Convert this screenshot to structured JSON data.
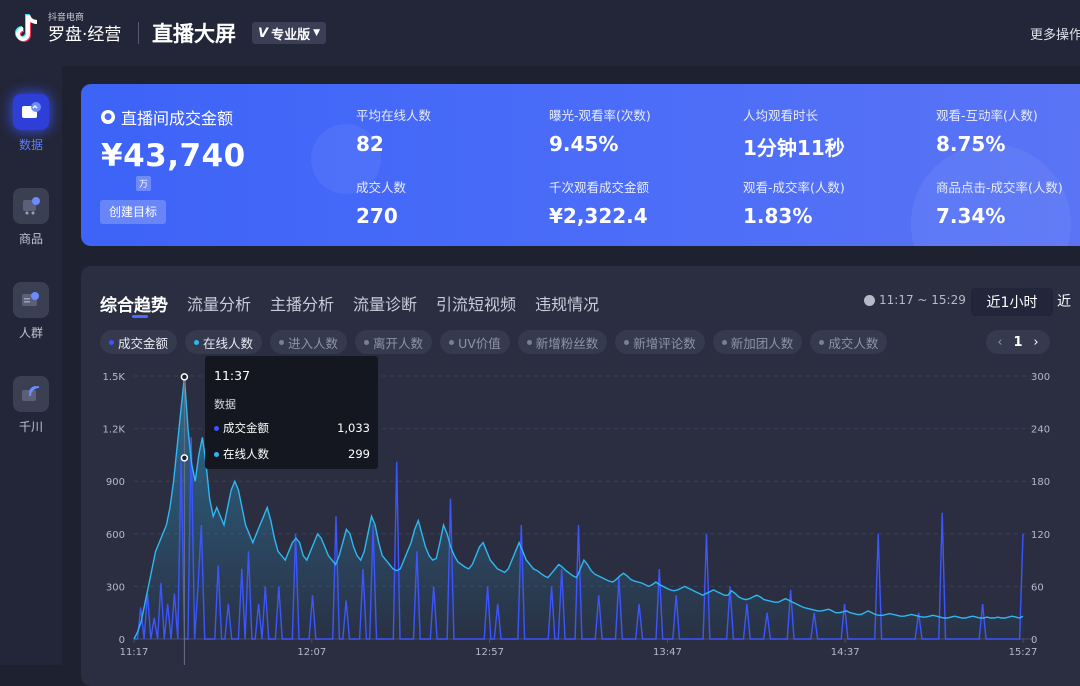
{
  "app": {
    "logo_small": "抖音电商",
    "logo_main": "罗盘·经营",
    "page_title": "直播大屏",
    "edition": "专业版",
    "more": "更多操作"
  },
  "sidebar": [
    {
      "label": "数据",
      "icon": "data-chart-icon",
      "active": true
    },
    {
      "label": "商品",
      "icon": "shopping-cart-icon",
      "active": false
    },
    {
      "label": "人群",
      "icon": "people-card-icon",
      "active": false
    },
    {
      "label": "千川",
      "icon": "signal-icon",
      "active": false
    }
  ],
  "hero": {
    "title": "直播间成交金额",
    "value": "¥43,740",
    "unit": "万",
    "button": "创建目标",
    "metrics": [
      {
        "label": "平均在线人数",
        "value": "82"
      },
      {
        "label": "曝光-观看率(次数)",
        "value": "9.45%"
      },
      {
        "label": "人均观看时长",
        "value": "1分钟11秒"
      },
      {
        "label": "观看-互动率(人数)",
        "value": "8.75%"
      },
      {
        "label": "成交人数",
        "value": "270"
      },
      {
        "label": "千次观看成交金额",
        "value": "¥2,322.4"
      },
      {
        "label": "观看-成交率(人数)",
        "value": "1.83%"
      },
      {
        "label": "商品点击-成交率(人数)",
        "value": "7.34%"
      }
    ]
  },
  "panel": {
    "tabs": [
      "综合趋势",
      "流量分析",
      "主播分析",
      "流量诊断",
      "引流短视频",
      "违规情况"
    ],
    "time_range": "11:17 ~ 15:29",
    "range_active": "近1小时",
    "range_next": "近",
    "chips": [
      {
        "label": "成交金额",
        "selected": true,
        "color": "#3d55ff"
      },
      {
        "label": "在线人数",
        "selected": true,
        "color": "#2fb7f0"
      },
      {
        "label": "进入人数",
        "selected": false
      },
      {
        "label": "离开人数",
        "selected": false
      },
      {
        "label": "UV价值",
        "selected": false
      },
      {
        "label": "新增粉丝数",
        "selected": false
      },
      {
        "label": "新增评论数",
        "selected": false
      },
      {
        "label": "新加团人数",
        "selected": false
      },
      {
        "label": "成交人数",
        "selected": false
      }
    ],
    "pager": {
      "prev": "‹",
      "page": "1",
      "next": "›"
    }
  },
  "tooltip": {
    "time": "11:37",
    "title": "数据",
    "rows": [
      {
        "label": "成交金额",
        "value": "1,033",
        "color": "#3d55ff"
      },
      {
        "label": "在线人数",
        "value": "299",
        "color": "#2fb7f0"
      }
    ]
  },
  "chart_data": {
    "type": "line",
    "x_ticks": [
      "11:17",
      "12:07",
      "12:57",
      "13:47",
      "14:37",
      "15:27"
    ],
    "y_left_ticks": [
      "0",
      "300",
      "600",
      "900",
      "1.2K",
      "1.5K"
    ],
    "y_right_ticks": [
      "0",
      "60",
      "120",
      "180",
      "240",
      "300"
    ],
    "ylim_left": [
      0,
      1500
    ],
    "ylim_right": [
      0,
      300
    ],
    "series": [
      {
        "name": "成交金额",
        "axis": "left",
        "color": "#3d55ff",
        "values": [
          0,
          0,
          180,
          0,
          260,
          0,
          120,
          0,
          320,
          0,
          200,
          0,
          260,
          0,
          1033,
          0,
          0,
          1150,
          0,
          300,
          650,
          0,
          0,
          0,
          0,
          420,
          0,
          0,
          200,
          0,
          0,
          0,
          400,
          0,
          500,
          0,
          0,
          200,
          0,
          300,
          0,
          0,
          0,
          300,
          0,
          0,
          0,
          0,
          600,
          0,
          0,
          0,
          0,
          250,
          0,
          0,
          0,
          0,
          0,
          0,
          700,
          0,
          0,
          220,
          0,
          0,
          0,
          0,
          400,
          0,
          0,
          650,
          0,
          0,
          0,
          0,
          0,
          0,
          1010,
          0,
          0,
          0,
          0,
          0,
          500,
          0,
          0,
          0,
          0,
          300,
          0,
          0,
          0,
          0,
          800,
          0,
          0,
          0,
          0,
          0,
          0,
          0,
          0,
          0,
          0,
          300,
          0,
          0,
          200,
          0,
          0,
          0,
          0,
          0,
          0,
          650,
          0,
          0,
          0,
          0,
          0,
          0,
          0,
          0,
          300,
          0,
          0,
          400,
          0,
          0,
          0,
          0,
          650,
          0,
          0,
          0,
          0,
          0,
          250,
          0,
          0,
          0,
          0,
          0,
          350,
          0,
          0,
          0,
          0,
          0,
          200,
          0,
          0,
          0,
          0,
          0,
          400,
          0,
          0,
          0,
          0,
          250,
          0,
          0,
          0,
          0,
          0,
          0,
          0,
          0,
          600,
          0,
          0,
          0,
          0,
          0,
          0,
          300,
          0,
          0,
          0,
          0,
          200,
          0,
          0,
          0,
          0,
          0,
          150,
          0,
          0,
          0,
          0,
          0,
          0,
          280,
          0,
          0,
          0,
          0,
          0,
          0,
          150,
          0,
          0,
          0,
          0,
          0,
          0,
          0,
          0,
          200,
          0,
          0,
          0,
          0,
          0,
          0,
          0,
          0,
          0,
          600,
          0,
          0,
          0,
          0,
          0,
          0,
          0,
          0,
          0,
          0,
          0,
          150,
          0,
          0,
          0,
          0,
          0,
          0,
          720,
          0,
          0,
          0,
          0,
          0,
          0,
          0,
          0,
          0,
          0,
          0,
          200,
          0,
          0,
          0,
          0,
          0,
          0,
          0,
          0,
          0,
          0,
          0,
          600
        ]
      },
      {
        "name": "在线人数",
        "axis": "right",
        "color": "#2fb7f0",
        "values": [
          0,
          8,
          20,
          40,
          60,
          80,
          100,
          110,
          120,
          130,
          150,
          180,
          220,
          260,
          299,
          240,
          200,
          180,
          210,
          230,
          200,
          160,
          140,
          150,
          140,
          130,
          150,
          170,
          180,
          170,
          150,
          130,
          120,
          110,
          120,
          130,
          140,
          150,
          135,
          115,
          100,
          95,
          90,
          100,
          110,
          115,
          110,
          95,
          90,
          100,
          110,
          120,
          115,
          105,
          95,
          90,
          85,
          95,
          110,
          125,
          120,
          105,
          95,
          90,
          100,
          120,
          140,
          130,
          110,
          95,
          90,
          85,
          80,
          78,
          80,
          90,
          100,
          110,
          125,
          135,
          120,
          105,
          95,
          90,
          92,
          110,
          130,
          120,
          105,
          95,
          88,
          85,
          82,
          80,
          85,
          95,
          105,
          110,
          100,
          90,
          85,
          80,
          78,
          76,
          80,
          90,
          100,
          110,
          100,
          90,
          85,
          80,
          78,
          75,
          72,
          70,
          75,
          80,
          85,
          82,
          78,
          75,
          72,
          70,
          80,
          90,
          85,
          78,
          74,
          72,
          70,
          68,
          66,
          65,
          68,
          72,
          75,
          72,
          68,
          66,
          65,
          64,
          62,
          60,
          62,
          65,
          62,
          60,
          58,
          56,
          55,
          56,
          58,
          60,
          58,
          56,
          54,
          52,
          50,
          52,
          54,
          56,
          54,
          52,
          50,
          50,
          55,
          52,
          48,
          46,
          45,
          46,
          48,
          50,
          48,
          45,
          44,
          43,
          42,
          42,
          44,
          46,
          44,
          42,
          40,
          38,
          36,
          35,
          34,
          33,
          32,
          32,
          33,
          34,
          32,
          30,
          30,
          31,
          32,
          30,
          29,
          28,
          28,
          30,
          32,
          30,
          28,
          27,
          27,
          28,
          29,
          28,
          27,
          26,
          26,
          27,
          28,
          27,
          26,
          25,
          25,
          26,
          27,
          26,
          25,
          24,
          24,
          25,
          26,
          25,
          24,
          24,
          25,
          26,
          25,
          24,
          24,
          25,
          24,
          24,
          25,
          24,
          24,
          25,
          26,
          25,
          24,
          26
        ]
      }
    ]
  }
}
